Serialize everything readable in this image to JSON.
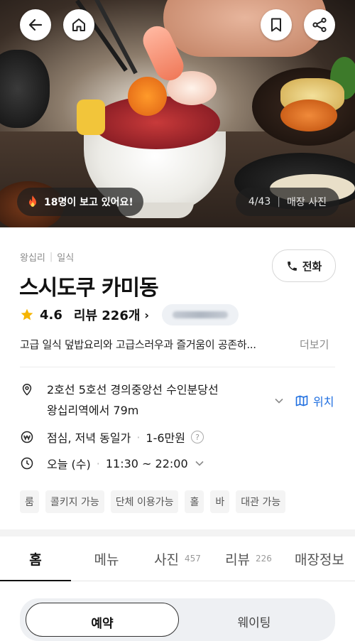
{
  "hero": {
    "viewers_text": "18명이 보고 있어요!",
    "photo_counter": "4/43",
    "photo_label": "매장 사진"
  },
  "place": {
    "region": "왕십리",
    "category": "일식",
    "name": "스시도쿠 카미동",
    "rating": "4.6",
    "review_label": "리뷰 226개",
    "call_label": "전화",
    "description": "고급 일식 덮밥요리와 고급스러우과 즐거움이 공존하...",
    "more_label": "더보기"
  },
  "info": {
    "address_line1": "2호선 5호선 경의중앙선 수인분당선",
    "address_line2": "왕십리역에서 79m",
    "location_label": "위치",
    "meal": "점심, 저녁 동일가",
    "price_range": "1-6만원",
    "help": "?",
    "today": "오늘 (수)",
    "hours": "11:30 ~ 22:00"
  },
  "tags": [
    "룸",
    "콜키지 가능",
    "단체 이용가능",
    "홀",
    "바",
    "대관 가능"
  ],
  "tabs": [
    {
      "label": "홈",
      "count": ""
    },
    {
      "label": "메뉴",
      "count": ""
    },
    {
      "label": "사진",
      "count": "457"
    },
    {
      "label": "리뷰",
      "count": "226"
    },
    {
      "label": "매장정보",
      "count": ""
    }
  ],
  "segment": {
    "option_a": "예약",
    "option_b": "웨이팅"
  },
  "colors": {
    "accent": "#1f6fe0",
    "star": "#f5b400",
    "fire": "#ff5a2a"
  },
  "icons": [
    "back-arrow-icon",
    "home-icon",
    "bookmark-icon",
    "share-icon",
    "fire-icon",
    "phone-icon",
    "star-icon",
    "location-pin-icon",
    "chevron-down-icon",
    "map-icon",
    "won-icon",
    "clock-icon"
  ]
}
